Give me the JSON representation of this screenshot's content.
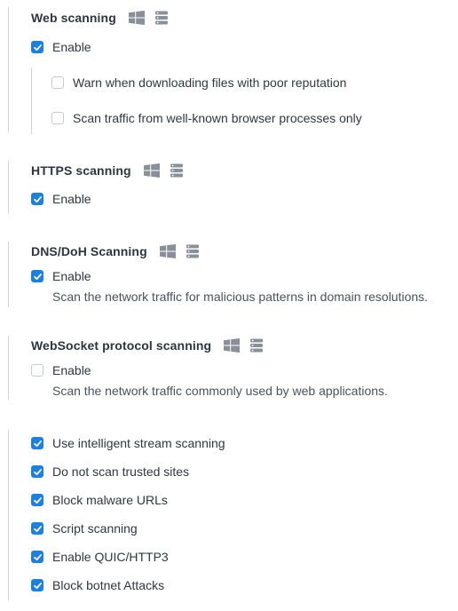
{
  "sections": {
    "web": {
      "title": "Web scanning",
      "enable": {
        "label": "Enable",
        "checked": true
      },
      "warn": {
        "label": "Warn when downloading files with poor reputation",
        "checked": false
      },
      "browser_only": {
        "label": "Scan traffic from well-known browser processes only",
        "checked": false
      }
    },
    "https": {
      "title": "HTTPS scanning",
      "enable": {
        "label": "Enable",
        "checked": true
      }
    },
    "dns": {
      "title": "DNS/DoH Scanning",
      "enable": {
        "label": "Enable",
        "checked": true
      },
      "description": "Scan the network traffic for malicious patterns in domain resolutions."
    },
    "websocket": {
      "title": "WebSocket protocol scanning",
      "enable": {
        "label": "Enable",
        "checked": false
      },
      "description": "Scan the network traffic commonly used by web applications."
    },
    "options": [
      {
        "label": "Use intelligent stream scanning",
        "checked": true
      },
      {
        "label": "Do not scan trusted sites",
        "checked": true
      },
      {
        "label": "Block malware URLs",
        "checked": true
      },
      {
        "label": "Script scanning",
        "checked": true
      },
      {
        "label": "Enable QUIC/HTTP3",
        "checked": true
      },
      {
        "label": "Block botnet Attacks",
        "checked": true
      }
    ]
  },
  "icons": {
    "os_windows": "windows-icon",
    "os_server": "server-icon"
  },
  "colors": {
    "accent": "#1d7fe0",
    "unchecked_border": "#c6cbd2",
    "section_bar": "#cfd3d9",
    "icon_gray": "#8a9099"
  }
}
